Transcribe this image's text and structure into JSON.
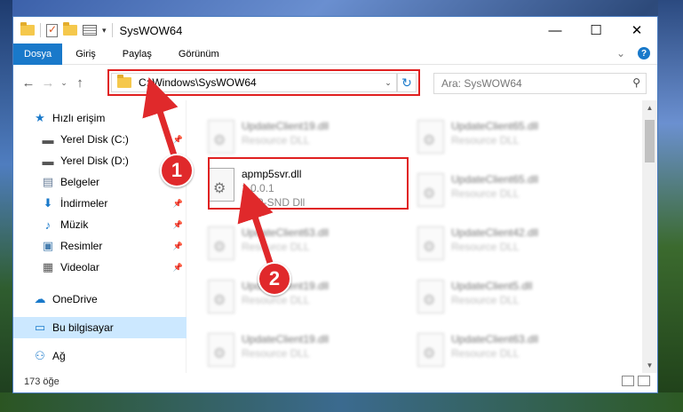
{
  "window": {
    "title": "SysWOW64",
    "controls": [
      "—",
      "☐",
      "✕"
    ]
  },
  "ribbon": {
    "tabs": [
      "Dosya",
      "Giriş",
      "Paylaş",
      "Görünüm"
    ],
    "expand": "⌄"
  },
  "address": {
    "path": "C:\\Windows\\SysWOW64",
    "search_placeholder": "Ara: SysWOW64"
  },
  "nav": {
    "items": [
      {
        "label": "Hızlı erişim",
        "icon": "star-icon",
        "glyph": "★",
        "color": "#1979ca",
        "pinned": false,
        "indent": 0
      },
      {
        "label": "Yerel Disk (C:)",
        "icon": "drive-icon",
        "glyph": "▬",
        "color": "#555",
        "pinned": true,
        "indent": 1
      },
      {
        "label": "Yerel Disk (D:)",
        "icon": "drive-icon",
        "glyph": "▬",
        "color": "#555",
        "pinned": true,
        "indent": 1
      },
      {
        "label": "Belgeler",
        "icon": "documents-icon",
        "glyph": "▤",
        "color": "#6a7f9a",
        "pinned": true,
        "indent": 1
      },
      {
        "label": "İndirmeler",
        "icon": "download-icon",
        "glyph": "⬇",
        "color": "#1979ca",
        "pinned": true,
        "indent": 1
      },
      {
        "label": "Müzik",
        "icon": "music-icon",
        "glyph": "♪",
        "color": "#1979ca",
        "pinned": true,
        "indent": 1
      },
      {
        "label": "Resimler",
        "icon": "pictures-icon",
        "glyph": "▣",
        "color": "#4a80b0",
        "pinned": true,
        "indent": 1
      },
      {
        "label": "Videolar",
        "icon": "video-icon",
        "glyph": "▦",
        "color": "#555",
        "pinned": true,
        "indent": 1
      },
      {
        "label": "OneDrive",
        "icon": "cloud-icon",
        "glyph": "☁",
        "color": "#1979ca",
        "pinned": false,
        "indent": 0
      },
      {
        "label": "Bu bilgisayar",
        "icon": "computer-icon",
        "glyph": "▭",
        "color": "#1979ca",
        "pinned": false,
        "indent": 0
      },
      {
        "label": "Ağ",
        "icon": "network-icon",
        "glyph": "⚇",
        "color": "#1979ca",
        "pinned": false,
        "indent": 0
      }
    ]
  },
  "files": {
    "highlighted": {
      "name": "apmp5svr.dll",
      "version": "1.0.0.1",
      "description": "ACP-SND Dll"
    },
    "blurred": [
      {
        "name": "UpdateClient19.dll",
        "type": "Resource DLL"
      },
      {
        "name": "UpdateClient65.dll",
        "type": "Resource DLL"
      },
      {
        "name": "UpdateClient65.dll",
        "type": "Resource DLL"
      },
      {
        "name": "UpdateClient63.dll",
        "type": "Resource DLL"
      },
      {
        "name": "UpdateClient42.dll",
        "type": "Resource DLL"
      },
      {
        "name": "UpdateClient19.dll",
        "type": "Resource DLL"
      },
      {
        "name": "UpdateClient5.dll",
        "type": "Resource DLL"
      },
      {
        "name": "UpdateClient19.dll",
        "type": "Resource DLL"
      },
      {
        "name": "UpdateClient63.dll",
        "type": "Resource DLL"
      }
    ]
  },
  "status": {
    "count": "173 öğe"
  },
  "callouts": [
    "1",
    "2"
  ],
  "colors": {
    "accent": "#1979ca",
    "highlight": "#e02020",
    "callout": "#e0292b"
  }
}
